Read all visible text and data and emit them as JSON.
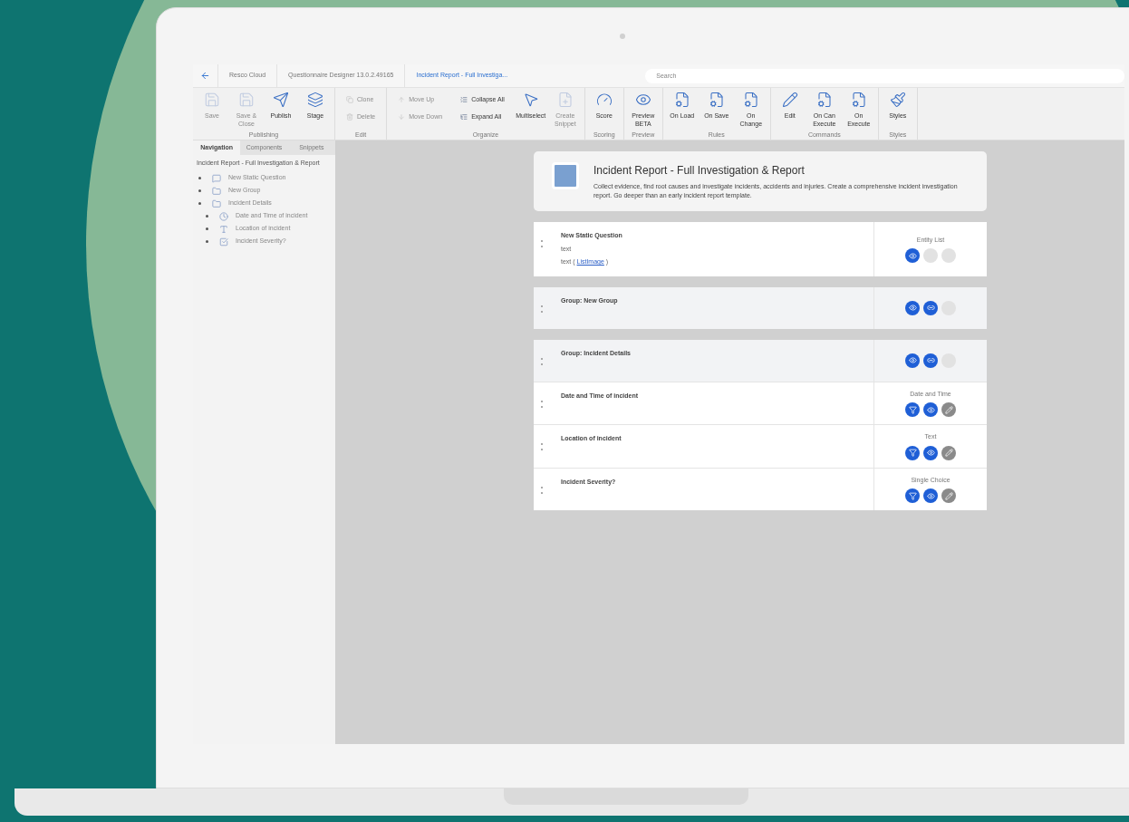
{
  "breadcrumbs": [
    {
      "label": "Resco Cloud",
      "selected": false
    },
    {
      "label": "Questionnaire Designer 13.0.2.49165",
      "selected": false
    },
    {
      "label": "Incident Report - Full Investiga...",
      "selected": true
    }
  ],
  "search": {
    "placeholder": "Search"
  },
  "ribbon": [
    {
      "group": "Publishing",
      "items": [
        {
          "kind": "save",
          "label": "Save",
          "disabled": true
        },
        {
          "kind": "saveclose",
          "label": "Save & Close",
          "disabled": true
        },
        {
          "kind": "publish",
          "label": "Publish",
          "disabled": false
        },
        {
          "kind": "stage",
          "label": "Stage",
          "disabled": false
        }
      ]
    },
    {
      "group": "Edit",
      "items": [
        {
          "kind": "clone",
          "label": "Clone",
          "disabled": true
        },
        {
          "kind": "delete",
          "label": "Delete",
          "disabled": true
        }
      ]
    },
    {
      "group": "Organize",
      "items": [
        {
          "kind": "moveup",
          "label": "Move Up",
          "disabled": true
        },
        {
          "kind": "movedown",
          "label": "Move Down",
          "disabled": true
        },
        {
          "kind": "collapse",
          "label": "Collapse All",
          "disabled": false
        },
        {
          "kind": "expand",
          "label": "Expand All",
          "disabled": false
        },
        {
          "kind": "multiselect",
          "label": "Multiselect",
          "disabled": false
        },
        {
          "kind": "snippet",
          "label": "Create Snippet",
          "disabled": true
        }
      ]
    },
    {
      "group": "Scoring",
      "items": [
        {
          "kind": "score",
          "label": "Score",
          "disabled": false
        }
      ]
    },
    {
      "group": "Preview",
      "items": [
        {
          "kind": "preview",
          "label": "Preview BETA",
          "disabled": false
        }
      ]
    },
    {
      "group": "Rules",
      "items": [
        {
          "kind": "rule",
          "label": "On Load",
          "disabled": false
        },
        {
          "kind": "rule",
          "label": "On Save",
          "disabled": false
        },
        {
          "kind": "rule",
          "label": "On Change",
          "disabled": false
        }
      ]
    },
    {
      "group": "Commands",
      "items": [
        {
          "kind": "edit",
          "label": "Edit",
          "disabled": false
        },
        {
          "kind": "rule",
          "label": "On Can Execute",
          "disabled": false
        },
        {
          "kind": "rule",
          "label": "On Execute",
          "disabled": false
        }
      ]
    },
    {
      "group": "Styles",
      "items": [
        {
          "kind": "styles",
          "label": "Styles",
          "disabled": false
        }
      ]
    }
  ],
  "sidebar": {
    "tabs": [
      {
        "label": "Navigation",
        "selected": true
      },
      {
        "label": "Components",
        "selected": false
      },
      {
        "label": "Snippets",
        "selected": false
      }
    ],
    "root": "Incident Report - Full Investigation & Report",
    "items": [
      {
        "kind": "static",
        "label": "New Static Question"
      },
      {
        "kind": "group",
        "label": "New Group"
      },
      {
        "kind": "group",
        "label": "Incident Details",
        "children": [
          {
            "kind": "datetime",
            "label": "Date and Time of incident"
          },
          {
            "kind": "text",
            "label": "Location of incident"
          },
          {
            "kind": "choice",
            "label": "Incident Severity?"
          }
        ]
      }
    ]
  },
  "header": {
    "title": "Incident Report - Full Investigation & Report",
    "description": "Collect evidence, find root causes and investigate incidents, accidents and injuries. Create a comprehensive incident investigation report. Go deeper than an early incident report template."
  },
  "blocks": [
    {
      "rows": [
        {
          "kind": "question",
          "title": "New Static Question",
          "type": "Entity List",
          "lines": [
            {
              "text": "text"
            },
            {
              "text": "text (",
              "link": "ListImage",
              "after": ")"
            }
          ],
          "actions": [
            {
              "kind": "eye",
              "on": true
            },
            {
              "kind": "blank",
              "on": false
            },
            {
              "kind": "blank",
              "on": false
            }
          ]
        }
      ]
    },
    {
      "rows": [
        {
          "kind": "group",
          "title": "Group: New Group",
          "actions": [
            {
              "kind": "eye",
              "on": true
            },
            {
              "kind": "link",
              "on": true
            },
            {
              "kind": "blank",
              "on": false
            }
          ]
        }
      ]
    },
    {
      "rows": [
        {
          "kind": "group",
          "title": "Group: Incident Details",
          "actions": [
            {
              "kind": "eye",
              "on": true
            },
            {
              "kind": "link",
              "on": true
            },
            {
              "kind": "blank",
              "on": false
            }
          ]
        },
        {
          "kind": "question",
          "title": "Date and Time of incident",
          "type": "Date and Time",
          "actions": [
            {
              "kind": "filter",
              "on": true
            },
            {
              "kind": "eye",
              "on": true
            },
            {
              "kind": "edit",
              "on": false
            }
          ]
        },
        {
          "kind": "question",
          "title": "Location of incident",
          "type": "Text",
          "actions": [
            {
              "kind": "filter",
              "on": true
            },
            {
              "kind": "eye",
              "on": true
            },
            {
              "kind": "edit",
              "on": false
            }
          ]
        },
        {
          "kind": "question",
          "title": "Incident Severity?",
          "type": "Single Choice",
          "actions": [
            {
              "kind": "filter",
              "on": true
            },
            {
              "kind": "eye",
              "on": true
            },
            {
              "kind": "edit",
              "on": false
            }
          ]
        }
      ]
    }
  ]
}
